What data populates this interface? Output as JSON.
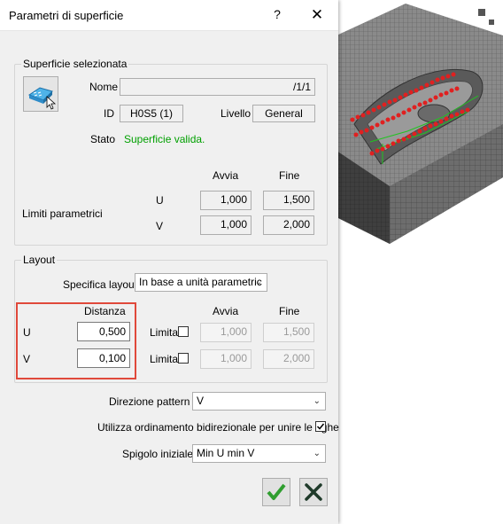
{
  "dialog": {
    "title": "Parametri di superficie",
    "help_label": "?",
    "close_label": "✕"
  },
  "selected_surface": {
    "group_title": "Superficie selezionata",
    "name_label": "Nome",
    "name_value": "/1/1",
    "id_label": "ID",
    "id_value": "H0S5 (1)",
    "level_label": "Livello",
    "level_value": "General",
    "state_label": "Stato",
    "state_value": "Superficie valida.",
    "state_color": "#00a000",
    "start_header": "Avvia",
    "end_header": "Fine",
    "param_limits_label": "Limiti parametrici",
    "u_label": "U",
    "v_label": "V",
    "u_start": "1,000",
    "u_end": "1,500",
    "v_start": "1,000",
    "v_end": "2,000"
  },
  "layout": {
    "group_title": "Layout",
    "spec_label": "Specifica layout",
    "spec_value": "In base a unità parametric",
    "distance_header": "Distanza",
    "start_header": "Avvia",
    "end_header": "Fine",
    "u_label": "U",
    "v_label": "V",
    "u_distance": "0,500",
    "v_distance": "0,100",
    "limit_label": "Limita",
    "u_limit_start": "1,000",
    "u_limit_end": "1,500",
    "v_limit_start": "1,000",
    "v_limit_end": "2,000",
    "u_limit_checked": false,
    "v_limit_checked": false
  },
  "options": {
    "pattern_direction_label": "Direzione pattern",
    "pattern_direction_value": "V",
    "bidirectional_label": "Utilizza ordinamento bidirezionale per unire le righe",
    "bidirectional_checked": true,
    "start_edge_label": "Spigolo iniziale",
    "start_edge_value": "Min U min V"
  },
  "colors": {
    "highlight": "#e0493b",
    "ok_green": "#2f9e2f",
    "cancel_dark": "#1f3a2a"
  }
}
